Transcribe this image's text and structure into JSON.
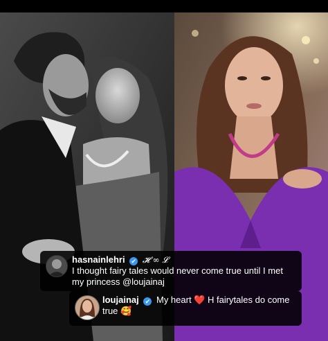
{
  "comments": [
    {
      "username": "hasnainlehri",
      "verified_mark": "✔",
      "bio_tag": "𝓗 ∞ 𝓛",
      "text": "I thought fairy tales would never come true until I met my princess @loujainaj"
    },
    {
      "username": "loujainaj",
      "verified_mark": "✔",
      "text_prefix": "My heart",
      "heart_emoji": "❤️",
      "text_suffix": "H fairytales do come true",
      "end_emoji": "🥰"
    }
  ],
  "colors": {
    "verified_badge": "#3897f0",
    "purple_dress": "#7a2fb0",
    "comment_bg": "#0b0b0b"
  }
}
